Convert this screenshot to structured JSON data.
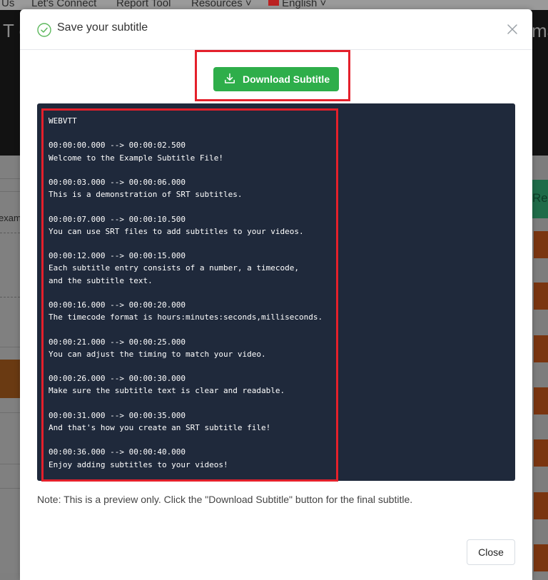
{
  "background": {
    "nav": [
      "Us",
      "Let's Connect",
      "Report Tool",
      "Resources",
      "English"
    ],
    "hero_left": "T e",
    "hero_right": "ma",
    "left_fragment": "exam",
    "right_button_fragment": "Re"
  },
  "modal": {
    "title": "Save your subtitle",
    "download_label": "Download Subtitle",
    "close_label": "Close",
    "note": "Note: This is a preview only. Click the \"Download Subtitle\" button for the final subtitle."
  },
  "subtitle": {
    "header": "WEBVTT",
    "cues": [
      {
        "time": "00:00:00.000 --> 00:00:02.500",
        "lines": [
          "Welcome to the Example Subtitle File!"
        ]
      },
      {
        "time": "00:00:03.000 --> 00:00:06.000",
        "lines": [
          "This is a demonstration of SRT subtitles."
        ]
      },
      {
        "time": "00:00:07.000 --> 00:00:10.500",
        "lines": [
          "You can use SRT files to add subtitles to your videos."
        ]
      },
      {
        "time": "00:00:12.000 --> 00:00:15.000",
        "lines": [
          "Each subtitle entry consists of a number, a timecode,",
          "and the subtitle text."
        ]
      },
      {
        "time": "00:00:16.000 --> 00:00:20.000",
        "lines": [
          "The timecode format is hours:minutes:seconds,milliseconds."
        ]
      },
      {
        "time": "00:00:21.000 --> 00:00:25.000",
        "lines": [
          "You can adjust the timing to match your video."
        ]
      },
      {
        "time": "00:00:26.000 --> 00:00:30.000",
        "lines": [
          "Make sure the subtitle text is clear and readable."
        ]
      },
      {
        "time": "00:00:31.000 --> 00:00:35.000",
        "lines": [
          "And that's how you create an SRT subtitle file!"
        ]
      },
      {
        "time": "00:00:36.000 --> 00:00:40.000",
        "lines": [
          "Enjoy adding subtitles to your videos!"
        ]
      }
    ]
  },
  "colors": {
    "accent_green": "#2eae4a",
    "highlight_red": "#e4202b",
    "preview_bg": "#1f293b"
  },
  "icons": [
    "check-circle-icon",
    "close-icon",
    "download-icon"
  ]
}
